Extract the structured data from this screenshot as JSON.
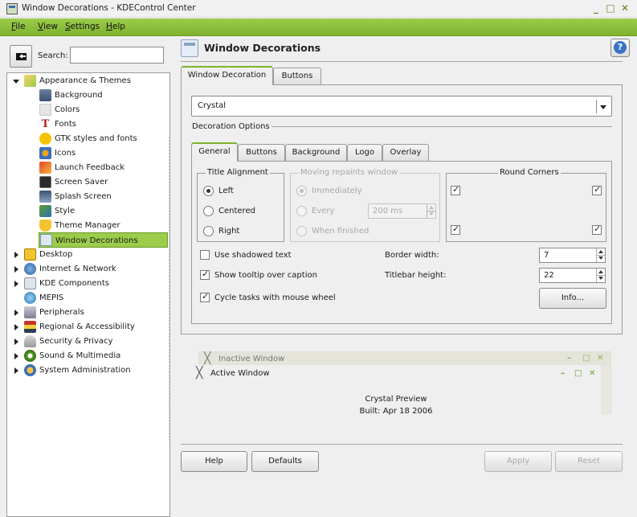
{
  "window": {
    "title": "Window Decorations - KDEControl Center",
    "controls": [
      "_",
      "□",
      "✕"
    ]
  },
  "menubar": {
    "items": [
      {
        "label": "File",
        "u": "F",
        "rest": "ile"
      },
      {
        "label": "View",
        "u": "V",
        "rest": "iew"
      },
      {
        "label": "Settings",
        "u": "S",
        "rest": "ettings"
      },
      {
        "label": "Help",
        "u": "H",
        "rest": "elp"
      }
    ]
  },
  "sidebar": {
    "search_label": "Search:",
    "search_value": "",
    "tree": [
      {
        "label": "Appearance & Themes",
        "expanded": true,
        "icon": "appearance-icon"
      },
      {
        "label": "Background",
        "icon": "background-icon"
      },
      {
        "label": "Colors",
        "icon": "colors-icon"
      },
      {
        "label": "Fonts",
        "icon": "fonts-icon"
      },
      {
        "label": "GTK styles and fonts",
        "icon": "gtk-icon"
      },
      {
        "label": "Icons",
        "icon": "icons-icon"
      },
      {
        "label": "Launch Feedback",
        "icon": "launch-feedback-icon"
      },
      {
        "label": "Screen Saver",
        "icon": "screensaver-icon"
      },
      {
        "label": "Splash Screen",
        "icon": "splash-icon"
      },
      {
        "label": "Style",
        "icon": "style-icon"
      },
      {
        "label": "Theme Manager",
        "icon": "theme-manager-icon"
      },
      {
        "label": "Window Decorations",
        "icon": "window-decorations-icon",
        "selected": true
      },
      {
        "label": "Desktop",
        "icon": "desktop-icon"
      },
      {
        "label": "Internet & Network",
        "icon": "network-icon"
      },
      {
        "label": "KDE Components",
        "icon": "kde-components-icon"
      },
      {
        "label": "MEPIS",
        "icon": "mepis-icon"
      },
      {
        "label": "Peripherals",
        "icon": "peripherals-icon"
      },
      {
        "label": "Regional & Accessibility",
        "icon": "regional-icon"
      },
      {
        "label": "Security & Privacy",
        "icon": "security-icon"
      },
      {
        "label": "Sound & Multimedia",
        "icon": "sound-icon"
      },
      {
        "label": "System Administration",
        "icon": "system-admin-icon"
      }
    ]
  },
  "main": {
    "title": "Window Decorations",
    "help_icon": "question-mark",
    "tabs": [
      "Window Decoration",
      "Buttons"
    ],
    "decoration": "Crystal",
    "decoration_options_label": "Decoration Options",
    "subtabs": [
      "General",
      "Buttons",
      "Background",
      "Logo",
      "Overlay"
    ],
    "title_alignment": {
      "label": "Title Alignment",
      "options": [
        "Left",
        "Centered",
        "Right"
      ],
      "selected": "Left"
    },
    "moving_repaints": {
      "label": "Moving repaints window",
      "options": [
        "Immediately",
        "Every",
        "When finished"
      ],
      "selected": "Immediately",
      "every_value": "200 ms"
    },
    "round_corners": {
      "label": "Round Corners",
      "checked": [
        true,
        true,
        true,
        true
      ]
    },
    "use_shadowed_text": {
      "label": "Use shadowed text",
      "checked": false
    },
    "show_tooltip": {
      "label": "Show tooltip over caption",
      "checked": true
    },
    "cycle_tasks": {
      "label": "Cycle tasks with mouse wheel",
      "checked": true
    },
    "border_width": {
      "label": "Border width:",
      "value": "7"
    },
    "titlebar_height": {
      "label": "Titlebar height:",
      "value": "22"
    },
    "info_button": "Info...",
    "preview": {
      "inactive_title": "Inactive Window",
      "active_title": "Active Window",
      "line1": "Crystal Preview",
      "line2": "Built: Apr 18 2006"
    },
    "buttons": {
      "help": "Help",
      "defaults": "Defaults",
      "apply": "Apply",
      "reset": "Reset"
    }
  },
  "colors": {
    "accent": "#9ccc4c",
    "accent_dark": "#6a9a20"
  }
}
